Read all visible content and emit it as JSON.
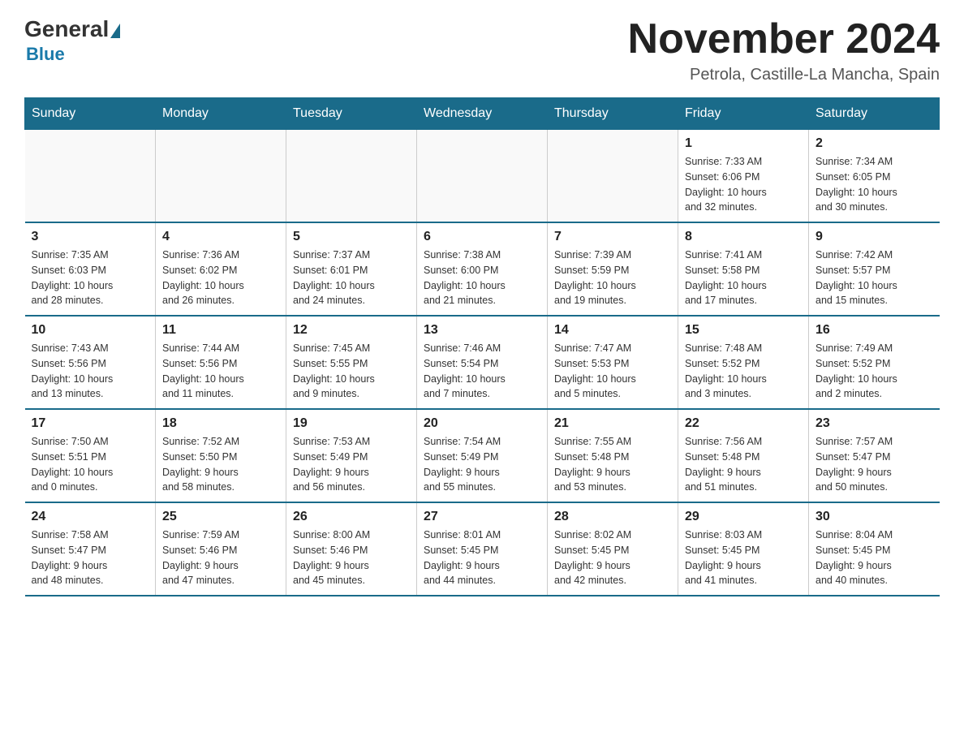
{
  "header": {
    "logo_general": "General",
    "logo_blue": "Blue",
    "month_title": "November 2024",
    "location": "Petrola, Castille-La Mancha, Spain"
  },
  "days_of_week": [
    "Sunday",
    "Monday",
    "Tuesday",
    "Wednesday",
    "Thursday",
    "Friday",
    "Saturday"
  ],
  "weeks": [
    [
      {
        "day": "",
        "info": ""
      },
      {
        "day": "",
        "info": ""
      },
      {
        "day": "",
        "info": ""
      },
      {
        "day": "",
        "info": ""
      },
      {
        "day": "",
        "info": ""
      },
      {
        "day": "1",
        "info": "Sunrise: 7:33 AM\nSunset: 6:06 PM\nDaylight: 10 hours\nand 32 minutes."
      },
      {
        "day": "2",
        "info": "Sunrise: 7:34 AM\nSunset: 6:05 PM\nDaylight: 10 hours\nand 30 minutes."
      }
    ],
    [
      {
        "day": "3",
        "info": "Sunrise: 7:35 AM\nSunset: 6:03 PM\nDaylight: 10 hours\nand 28 minutes."
      },
      {
        "day": "4",
        "info": "Sunrise: 7:36 AM\nSunset: 6:02 PM\nDaylight: 10 hours\nand 26 minutes."
      },
      {
        "day": "5",
        "info": "Sunrise: 7:37 AM\nSunset: 6:01 PM\nDaylight: 10 hours\nand 24 minutes."
      },
      {
        "day": "6",
        "info": "Sunrise: 7:38 AM\nSunset: 6:00 PM\nDaylight: 10 hours\nand 21 minutes."
      },
      {
        "day": "7",
        "info": "Sunrise: 7:39 AM\nSunset: 5:59 PM\nDaylight: 10 hours\nand 19 minutes."
      },
      {
        "day": "8",
        "info": "Sunrise: 7:41 AM\nSunset: 5:58 PM\nDaylight: 10 hours\nand 17 minutes."
      },
      {
        "day": "9",
        "info": "Sunrise: 7:42 AM\nSunset: 5:57 PM\nDaylight: 10 hours\nand 15 minutes."
      }
    ],
    [
      {
        "day": "10",
        "info": "Sunrise: 7:43 AM\nSunset: 5:56 PM\nDaylight: 10 hours\nand 13 minutes."
      },
      {
        "day": "11",
        "info": "Sunrise: 7:44 AM\nSunset: 5:56 PM\nDaylight: 10 hours\nand 11 minutes."
      },
      {
        "day": "12",
        "info": "Sunrise: 7:45 AM\nSunset: 5:55 PM\nDaylight: 10 hours\nand 9 minutes."
      },
      {
        "day": "13",
        "info": "Sunrise: 7:46 AM\nSunset: 5:54 PM\nDaylight: 10 hours\nand 7 minutes."
      },
      {
        "day": "14",
        "info": "Sunrise: 7:47 AM\nSunset: 5:53 PM\nDaylight: 10 hours\nand 5 minutes."
      },
      {
        "day": "15",
        "info": "Sunrise: 7:48 AM\nSunset: 5:52 PM\nDaylight: 10 hours\nand 3 minutes."
      },
      {
        "day": "16",
        "info": "Sunrise: 7:49 AM\nSunset: 5:52 PM\nDaylight: 10 hours\nand 2 minutes."
      }
    ],
    [
      {
        "day": "17",
        "info": "Sunrise: 7:50 AM\nSunset: 5:51 PM\nDaylight: 10 hours\nand 0 minutes."
      },
      {
        "day": "18",
        "info": "Sunrise: 7:52 AM\nSunset: 5:50 PM\nDaylight: 9 hours\nand 58 minutes."
      },
      {
        "day": "19",
        "info": "Sunrise: 7:53 AM\nSunset: 5:49 PM\nDaylight: 9 hours\nand 56 minutes."
      },
      {
        "day": "20",
        "info": "Sunrise: 7:54 AM\nSunset: 5:49 PM\nDaylight: 9 hours\nand 55 minutes."
      },
      {
        "day": "21",
        "info": "Sunrise: 7:55 AM\nSunset: 5:48 PM\nDaylight: 9 hours\nand 53 minutes."
      },
      {
        "day": "22",
        "info": "Sunrise: 7:56 AM\nSunset: 5:48 PM\nDaylight: 9 hours\nand 51 minutes."
      },
      {
        "day": "23",
        "info": "Sunrise: 7:57 AM\nSunset: 5:47 PM\nDaylight: 9 hours\nand 50 minutes."
      }
    ],
    [
      {
        "day": "24",
        "info": "Sunrise: 7:58 AM\nSunset: 5:47 PM\nDaylight: 9 hours\nand 48 minutes."
      },
      {
        "day": "25",
        "info": "Sunrise: 7:59 AM\nSunset: 5:46 PM\nDaylight: 9 hours\nand 47 minutes."
      },
      {
        "day": "26",
        "info": "Sunrise: 8:00 AM\nSunset: 5:46 PM\nDaylight: 9 hours\nand 45 minutes."
      },
      {
        "day": "27",
        "info": "Sunrise: 8:01 AM\nSunset: 5:45 PM\nDaylight: 9 hours\nand 44 minutes."
      },
      {
        "day": "28",
        "info": "Sunrise: 8:02 AM\nSunset: 5:45 PM\nDaylight: 9 hours\nand 42 minutes."
      },
      {
        "day": "29",
        "info": "Sunrise: 8:03 AM\nSunset: 5:45 PM\nDaylight: 9 hours\nand 41 minutes."
      },
      {
        "day": "30",
        "info": "Sunrise: 8:04 AM\nSunset: 5:45 PM\nDaylight: 9 hours\nand 40 minutes."
      }
    ]
  ]
}
